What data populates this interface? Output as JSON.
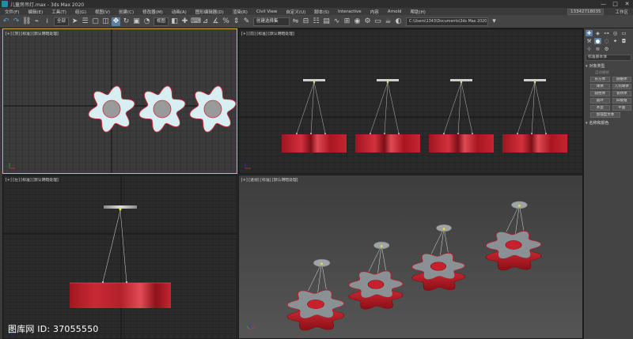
{
  "titlebar": {
    "title": "儿童房吊灯.max - 3ds Max 2020",
    "minimize": "—",
    "maximize": "□",
    "close": "✕"
  },
  "menubar": {
    "items": [
      "文件(F)",
      "编辑(E)",
      "工具(T)",
      "组(G)",
      "视图(V)",
      "创建(C)",
      "修改器(M)",
      "动画(A)",
      "图形编辑器(D)",
      "渲染(R)",
      "Civil View",
      "自定义(U)",
      "脚本(S)",
      "Interactive",
      "内容",
      "Arnold",
      "帮助(H)"
    ],
    "user": "13342718035",
    "workspace": "工作区"
  },
  "toolbar": {
    "filter_select": "全部",
    "view_select": "视图",
    "selection_set": "创建选择集",
    "path": "C:\\Users\\1343\\Documents\\3ds Max 2020"
  },
  "viewports": {
    "top": {
      "label": "[+] [顶] [标准] [默认明暗处理]"
    },
    "front": {
      "label": "[+] [前] [标准] [默认明暗处理]"
    },
    "left": {
      "label": "[+] [左] [标准] [默认明暗处理]"
    },
    "perspective": {
      "label": "[+] [透视] [标准] [默认明暗处理]"
    }
  },
  "command_panel": {
    "field": "标准基本体",
    "rollout_object_type": "对象类型",
    "autogrid": "自动栅格",
    "buttons": [
      "长方体",
      "圆锥体",
      "球体",
      "几何球体",
      "圆柱体",
      "管状体",
      "圆环",
      "四棱锥",
      "茶壶",
      "平面"
    ],
    "extra_button": "加强型文本",
    "rollout_name_color": "名称和颜色"
  },
  "watermark": "图库网 ID: 37055550",
  "colors": {
    "lamp_red": "#c8202c",
    "lamp_gray": "#8a9194",
    "top_view_fill": "#d7eef2",
    "active_border": "#d8b84a"
  }
}
